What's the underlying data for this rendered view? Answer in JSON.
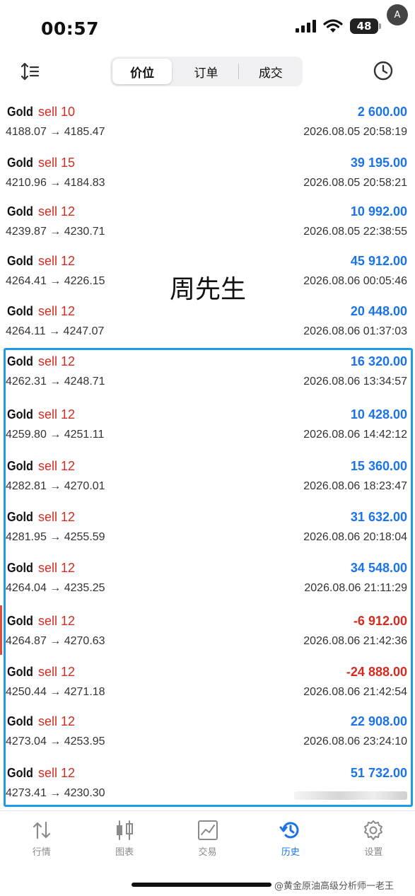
{
  "status": {
    "time": "00:57",
    "battery": "48"
  },
  "tabs": [
    {
      "label": "价位"
    },
    {
      "label": "订单"
    },
    {
      "label": "成交"
    }
  ],
  "overlay_name": "周先生",
  "deals": [
    {
      "symbol": "Gold",
      "side": "sell 10",
      "prices": "4188.07 → 4185.47",
      "profit": "2 600.00",
      "time": "2026.08.05 20:58:19"
    },
    {
      "symbol": "Gold",
      "side": "sell 15",
      "prices": "4210.96 → 4184.83",
      "profit": "39 195.00",
      "time": "2026.08.05 20:58:21"
    },
    {
      "symbol": "Gold",
      "side": "sell 12",
      "prices": "4239.87 → 4230.71",
      "profit": "10 992.00",
      "time": "2026.08.05 22:38:55"
    },
    {
      "symbol": "Gold",
      "side": "sell 12",
      "prices": "4264.41 → 4226.15",
      "profit": "45 912.00",
      "time": "2026.08.06 00:05:46"
    },
    {
      "symbol": "Gold",
      "side": "sell 12",
      "prices": "4264.11 → 4247.07",
      "profit": "20 448.00",
      "time": "2026.08.06 01:37:03"
    },
    {
      "symbol": "Gold",
      "side": "sell 12",
      "prices": "4262.31 → 4248.71",
      "profit": "16 320.00",
      "time": "2026.08.06 13:34:57"
    },
    {
      "symbol": "Gold",
      "side": "sell 12",
      "prices": "4259.80 → 4251.11",
      "profit": "10 428.00",
      "time": "2026.08.06 14:42:12"
    },
    {
      "symbol": "Gold",
      "side": "sell 12",
      "prices": "4282.81 → 4270.01",
      "profit": "15 360.00",
      "time": "2026.08.06 18:23:47"
    },
    {
      "symbol": "Gold",
      "side": "sell 12",
      "prices": "4281.95 → 4255.59",
      "profit": "31 632.00",
      "time": "2026.08.06 20:18:04"
    },
    {
      "symbol": "Gold",
      "side": "sell 12",
      "prices": "4264.04 → 4235.25",
      "profit": "34 548.00",
      "time": "2026.08.06 21:11:29"
    },
    {
      "symbol": "Gold",
      "side": "sell 12",
      "prices": "4264.87 → 4270.63",
      "profit": "-6 912.00",
      "time": "2026.08.06 21:42:36"
    },
    {
      "symbol": "Gold",
      "side": "sell 12",
      "prices": "4250.44 → 4271.18",
      "profit": "-24 888.00",
      "time": "2026.08.06 21:42:54"
    },
    {
      "symbol": "Gold",
      "side": "sell 12",
      "prices": "4273.04 → 4253.95",
      "profit": "22 908.00",
      "time": "2026.08.06 23:24:10"
    },
    {
      "symbol": "Gold",
      "side": "sell 12",
      "prices": "4273.41 → 4230.30",
      "profit": "51 732.00",
      "time": ""
    }
  ],
  "nav": [
    {
      "label": "行情",
      "icon": "arrows-updown-icon",
      "active": false
    },
    {
      "label": "图表",
      "icon": "candlestick-icon",
      "active": false
    },
    {
      "label": "交易",
      "icon": "chart-line-icon",
      "active": false
    },
    {
      "label": "历史",
      "icon": "history-clock-icon",
      "active": true
    },
    {
      "label": "设置",
      "icon": "gear-icon",
      "active": false
    }
  ],
  "watermark": "@黄金原油高级分析师一老王",
  "colors": {
    "profit_positive": "#1a73e8",
    "profit_negative": "#d52b1e",
    "sell": "#d52b1e",
    "highlight_border": "#1e9be8",
    "nav_active": "#1a73e8"
  }
}
